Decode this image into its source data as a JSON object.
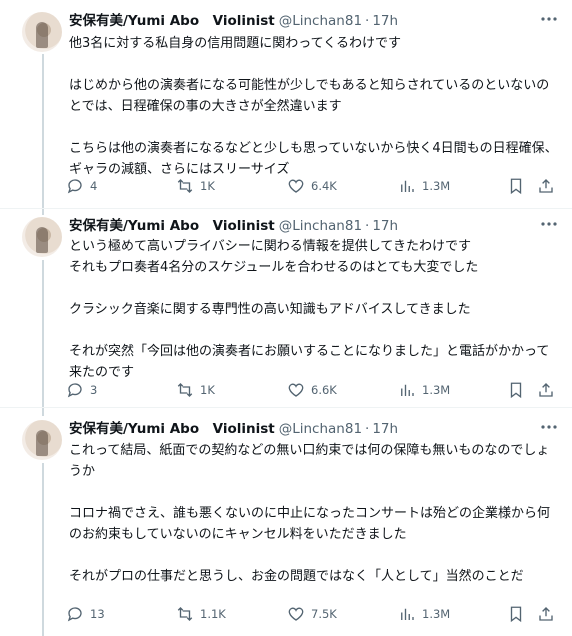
{
  "author": {
    "name": "安保有美/Yumi Abo　Violinist",
    "handle": "@Linchan81",
    "separator": "·",
    "time": "17h"
  },
  "tweets": [
    {
      "text": "他3名に対する私自身の信用問題に関わってくるわけです\n\nはじめから他の演奏者になる可能性が少しでもあると知らされているのといないのとでは、日程確保の事の大きさが全然違います\n\nこちらは他の演奏者になるなどと少しも思っていないから快く4日間もの日程確保、ギャラの減額、さらにはスリーサイズ",
      "replies": "4",
      "reposts": "1K",
      "likes": "6.4K",
      "views": "1.3M"
    },
    {
      "text": "という極めて高いプライバシーに関わる情報を提供してきたわけです\nそれもプロ奏者4名分のスケジュールを合わせるのはとても大変でした\n\nクラシック音楽に関する専門性の高い知識もアドバイスしてきました\n\nそれが突然「今回は他の演奏者にお願いすることになりました」と電話がかかって来たのです",
      "replies": "3",
      "reposts": "1K",
      "likes": "6.6K",
      "views": "1.3M"
    },
    {
      "text": "これって結局、紙面での契約などの無い口約束では何の保障も無いものなのでしょうか\n\nコロナ禍でさえ、誰も悪くないのに中止になったコンサートは殆どの企業様から何のお約束もしていないのにキャンセル料をいただきました\n\nそれがプロの仕事だと思うし、お金の問題ではなく「人として」当然のことだ",
      "replies": "13",
      "reposts": "1.1K",
      "likes": "7.5K",
      "views": "1.3M"
    }
  ],
  "icons": {
    "more": "more-horizontal-icon",
    "reply": "reply-bubble-icon",
    "repost": "repost-arrows-icon",
    "like": "heart-icon",
    "views": "views-bar-chart-icon",
    "bookmark": "bookmark-icon",
    "share": "share-upload-icon"
  },
  "colors": {
    "text": "#0f1419",
    "secondary": "#536471",
    "divider": "#eff3f4",
    "thread": "#cfd9de"
  }
}
